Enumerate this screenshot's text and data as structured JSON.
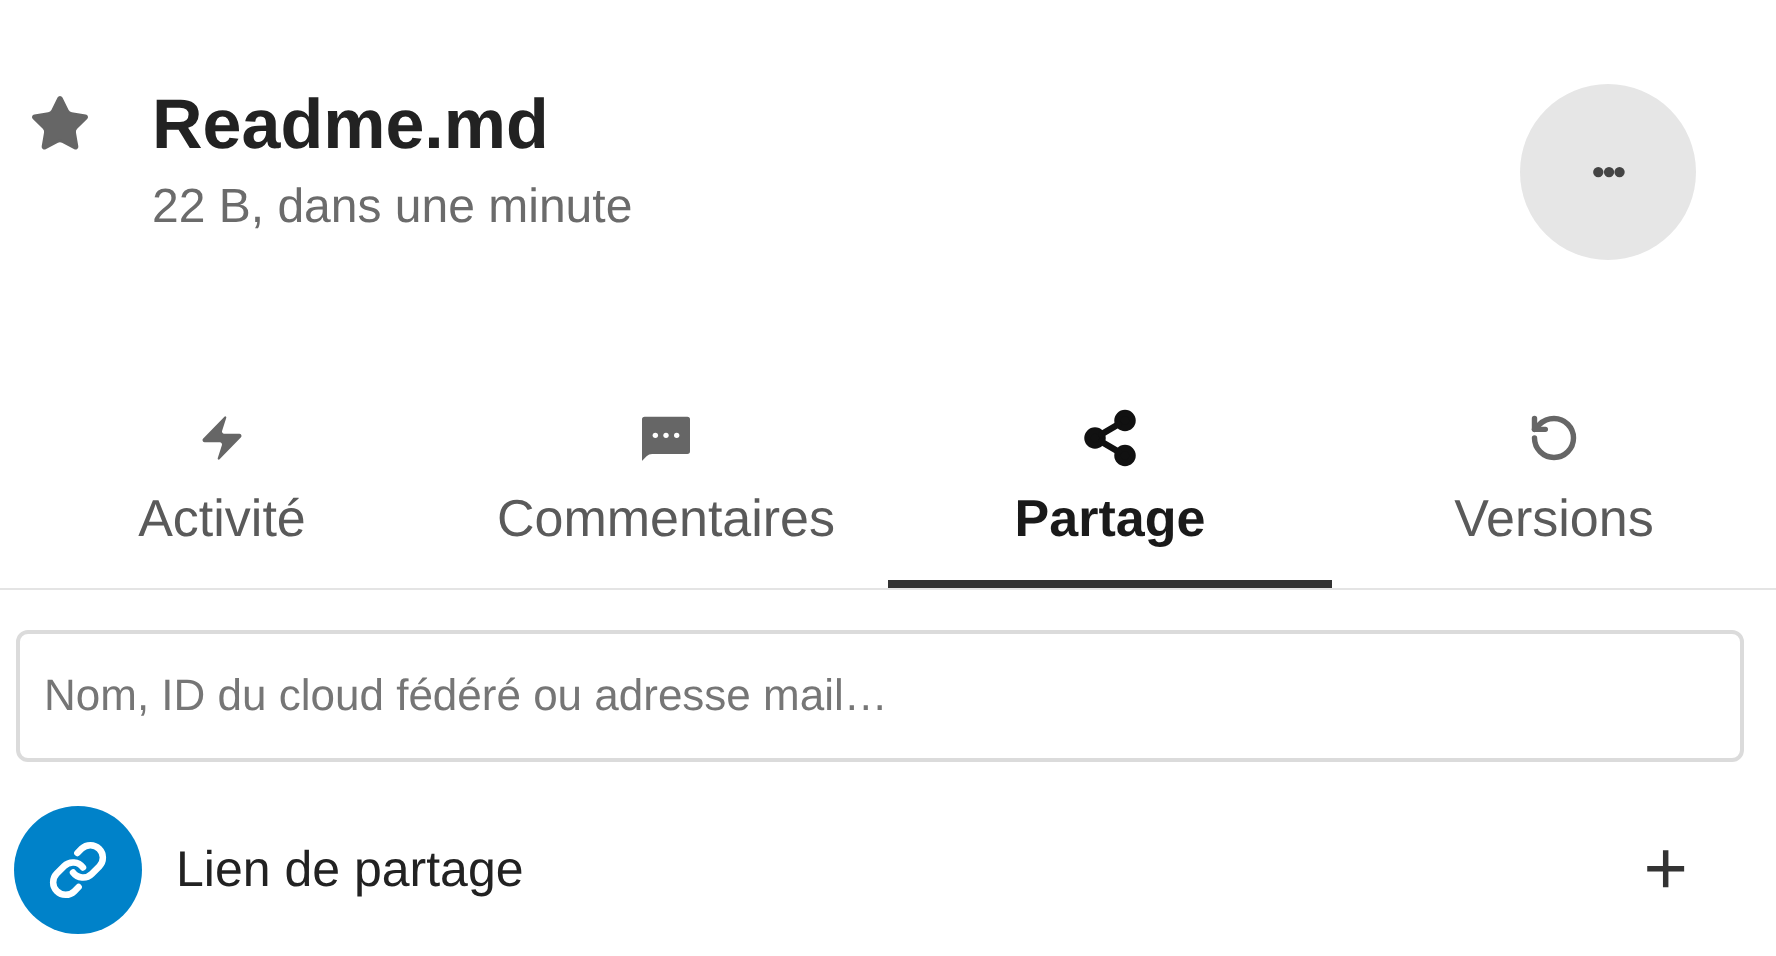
{
  "file": {
    "name": "Readme.md",
    "details": "22 B, dans une minute",
    "favorite": true
  },
  "menu_button": {
    "label": "•••"
  },
  "tabs": [
    {
      "label": "Activité",
      "kind": "activity",
      "selected": false
    },
    {
      "label": "Commentaires",
      "kind": "comments",
      "selected": false
    },
    {
      "label": "Partage",
      "kind": "share",
      "selected": true
    },
    {
      "label": "Versions",
      "kind": "versions",
      "selected": false
    }
  ],
  "search": {
    "placeholder": "Nom, ID du cloud fédéré ou adresse mail…"
  },
  "share_link": {
    "label": "Lien de partage",
    "add": "+"
  }
}
